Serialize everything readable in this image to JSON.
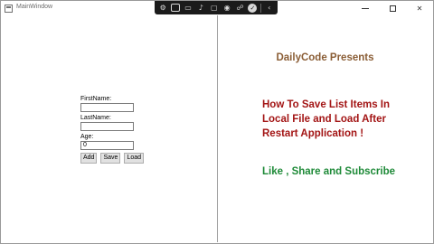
{
  "window": {
    "title": "MainWindow",
    "controls": {
      "minimize": "minimize-icon",
      "maximize": "maximize-icon",
      "close": "close-icon"
    }
  },
  "toolbar": {
    "icons": [
      "settings-icon",
      "rectangle-icon",
      "video-icon",
      "microphone-icon",
      "screen-icon",
      "camera-icon",
      "share-icon",
      "check-icon",
      "chevron-left-icon"
    ]
  },
  "form": {
    "first_name_label": "FirstName:",
    "first_name_value": "",
    "last_name_label": "LastName:",
    "last_name_value": "",
    "age_label": "Age:",
    "age_value": "0",
    "add_label": "Add",
    "save_label": "Save",
    "load_label": "Load"
  },
  "overlay": {
    "heading": "DailyCode Presents",
    "topic_lines": [
      "How To Save List Items In",
      "Local File and Load After",
      "Restart Application !"
    ],
    "cta": "Like , Share and Subscribe",
    "colors": {
      "heading": "#8a5d35",
      "topic": "#a31515",
      "cta": "#1e8a38"
    }
  }
}
